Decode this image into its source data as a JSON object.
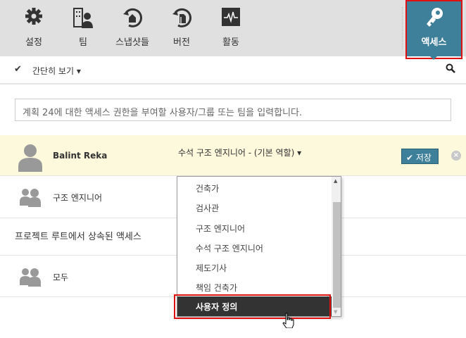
{
  "toolbar": {
    "items": [
      {
        "label": "설정",
        "icon": "gear-icon"
      },
      {
        "label": "팀",
        "icon": "team-icon"
      },
      {
        "label": "스냅샷들",
        "icon": "snapshot-icon"
      },
      {
        "label": "버전",
        "icon": "version-icon"
      },
      {
        "label": "활동",
        "icon": "activity-icon"
      }
    ],
    "access": {
      "label": "액세스",
      "icon": "key-icon"
    }
  },
  "view": {
    "label": "간단히 보기"
  },
  "input": {
    "placeholder": "계획 24에 대한 액세스 권한을 부여할 사용자/그룹 또는 팀을 입력합니다."
  },
  "rows": [
    {
      "name": "Balint Reka",
      "role": "수석 구조 엔지니어 - (기본 역할)",
      "save": "저장"
    },
    {
      "name": "구조 엔지니어"
    }
  ],
  "inherited": {
    "heading": "프로젝트 루트에서 상속된 액세스",
    "rows": [
      {
        "name": "모두"
      }
    ]
  },
  "dropdown": {
    "options": [
      "건축가",
      "검사관",
      "구조 엔지니어",
      "수석 구조 엔지니어",
      "제도기사",
      "책임 건축가",
      "사용자 정의"
    ],
    "selected": "사용자 정의"
  },
  "colors": {
    "accent": "#3e7f99",
    "highlight": "#fdf9dc",
    "outline": "#e01010"
  }
}
